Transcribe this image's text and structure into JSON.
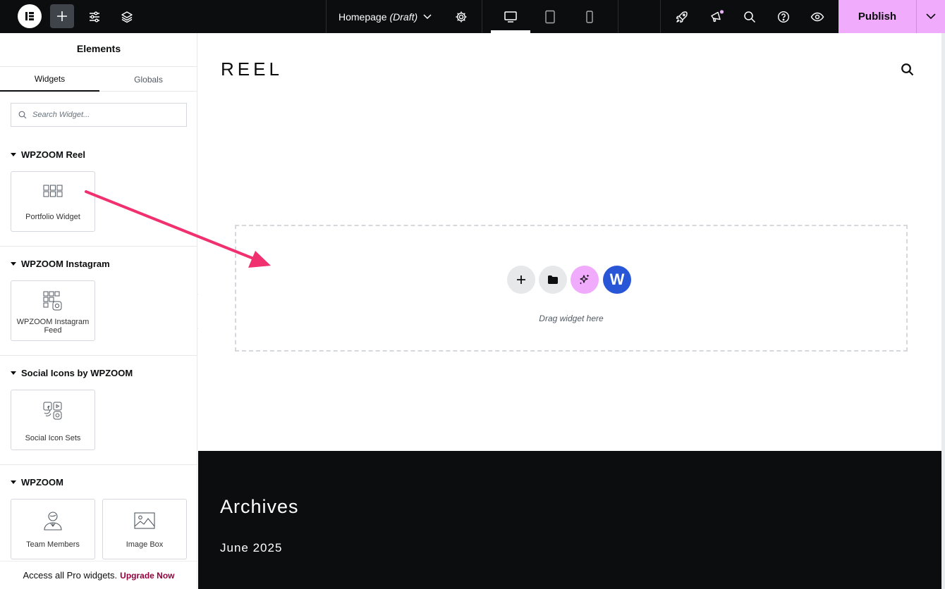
{
  "topbar": {
    "page_name": "Homepage",
    "page_status": "(Draft)",
    "publish_label": "Publish"
  },
  "panel": {
    "title": "Elements",
    "tabs": [
      "Widgets",
      "Globals"
    ],
    "search_placeholder": "Search Widget...",
    "categories": [
      {
        "title": "WPZOOM Reel",
        "widgets": [
          "Portfolio Widget"
        ]
      },
      {
        "title": "WPZOOM Instagram",
        "widgets": [
          "WPZOOM Instagram Feed"
        ]
      },
      {
        "title": "Social Icons by WPZOOM",
        "widgets": [
          "Social Icon Sets"
        ]
      },
      {
        "title": "WPZOOM",
        "widgets": [
          "Team Members",
          "Image Box"
        ]
      }
    ],
    "promo_text": "Access all Pro widgets.",
    "promo_link": "Upgrade Now"
  },
  "canvas": {
    "site_logo": "REEL",
    "drop_text": "Drag widget here",
    "dz_logo_letter": "W",
    "footer_title": "Archives",
    "footer_link": "June 2025"
  },
  "colors": {
    "topbar_bg": "#0c0d0e",
    "publish_bg": "#f0abfc",
    "ai_button": "#f0abfc",
    "wpzoom_button": "#2856d6",
    "arrow": "#f0306f",
    "upgrade_link": "#93003f"
  }
}
